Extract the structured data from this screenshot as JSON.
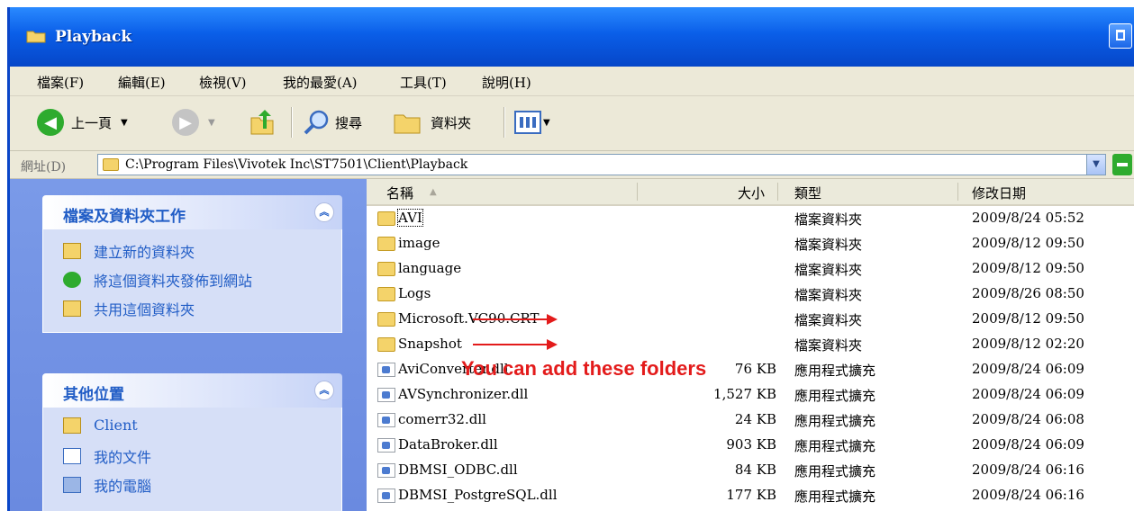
{
  "window": {
    "title": "Playback"
  },
  "menu": [
    "檔案(F)",
    "編輯(E)",
    "檢視(V)",
    "我的最愛(A)",
    "工具(T)",
    "說明(H)"
  ],
  "toolbar": {
    "back_label": "上一頁",
    "search_label": "搜尋",
    "folders_label": "資料夾"
  },
  "address": {
    "label": "網址(D)",
    "path": "C:\\Program Files\\Vivotek Inc\\ST7501\\Client\\Playback"
  },
  "sidebar": {
    "tasks": {
      "title": "檔案及資料夾工作",
      "items": [
        "建立新的資料夾",
        "將這個資料夾發佈到網站",
        "共用這個資料夾"
      ]
    },
    "places": {
      "title": "其他位置",
      "items": [
        "Client",
        "我的文件",
        "我的電腦"
      ]
    }
  },
  "columns": {
    "name": "名稱",
    "size": "大小",
    "type": "類型",
    "modified": "修改日期"
  },
  "files": [
    {
      "name": "AVI",
      "size": "",
      "type": "檔案資料夾",
      "modified": "2009/8/24 05:52",
      "kind": "folder"
    },
    {
      "name": "image",
      "size": "",
      "type": "檔案資料夾",
      "modified": "2009/8/12 09:50",
      "kind": "folder"
    },
    {
      "name": "language",
      "size": "",
      "type": "檔案資料夾",
      "modified": "2009/8/12 09:50",
      "kind": "folder"
    },
    {
      "name": "Logs",
      "size": "",
      "type": "檔案資料夾",
      "modified": "2009/8/26 08:50",
      "kind": "folder"
    },
    {
      "name": "Microsoft.VC90.CRT",
      "size": "",
      "type": "檔案資料夾",
      "modified": "2009/8/12 09:50",
      "kind": "folder"
    },
    {
      "name": "Snapshot",
      "size": "",
      "type": "檔案資料夾",
      "modified": "2009/8/12 02:20",
      "kind": "folder"
    },
    {
      "name": "AviConverter.dll",
      "size": "76 KB",
      "type": "應用程式擴充",
      "modified": "2009/8/24 06:09",
      "kind": "dll"
    },
    {
      "name": "AVSynchronizer.dll",
      "size": "1,527 KB",
      "type": "應用程式擴充",
      "modified": "2009/8/24 06:09",
      "kind": "dll"
    },
    {
      "name": "comerr32.dll",
      "size": "24 KB",
      "type": "應用程式擴充",
      "modified": "2009/8/24 06:08",
      "kind": "dll"
    },
    {
      "name": "DataBroker.dll",
      "size": "903 KB",
      "type": "應用程式擴充",
      "modified": "2009/8/24 06:09",
      "kind": "dll"
    },
    {
      "name": "DBMSI_ODBC.dll",
      "size": "84 KB",
      "type": "應用程式擴充",
      "modified": "2009/8/24 06:16",
      "kind": "dll"
    },
    {
      "name": "DBMSI_PostgreSQL.dll",
      "size": "177 KB",
      "type": "應用程式擴充",
      "modified": "2009/8/24 06:16",
      "kind": "dll"
    }
  ],
  "annotation": {
    "text": "You can add these folders",
    "color": "#e31b1b"
  }
}
